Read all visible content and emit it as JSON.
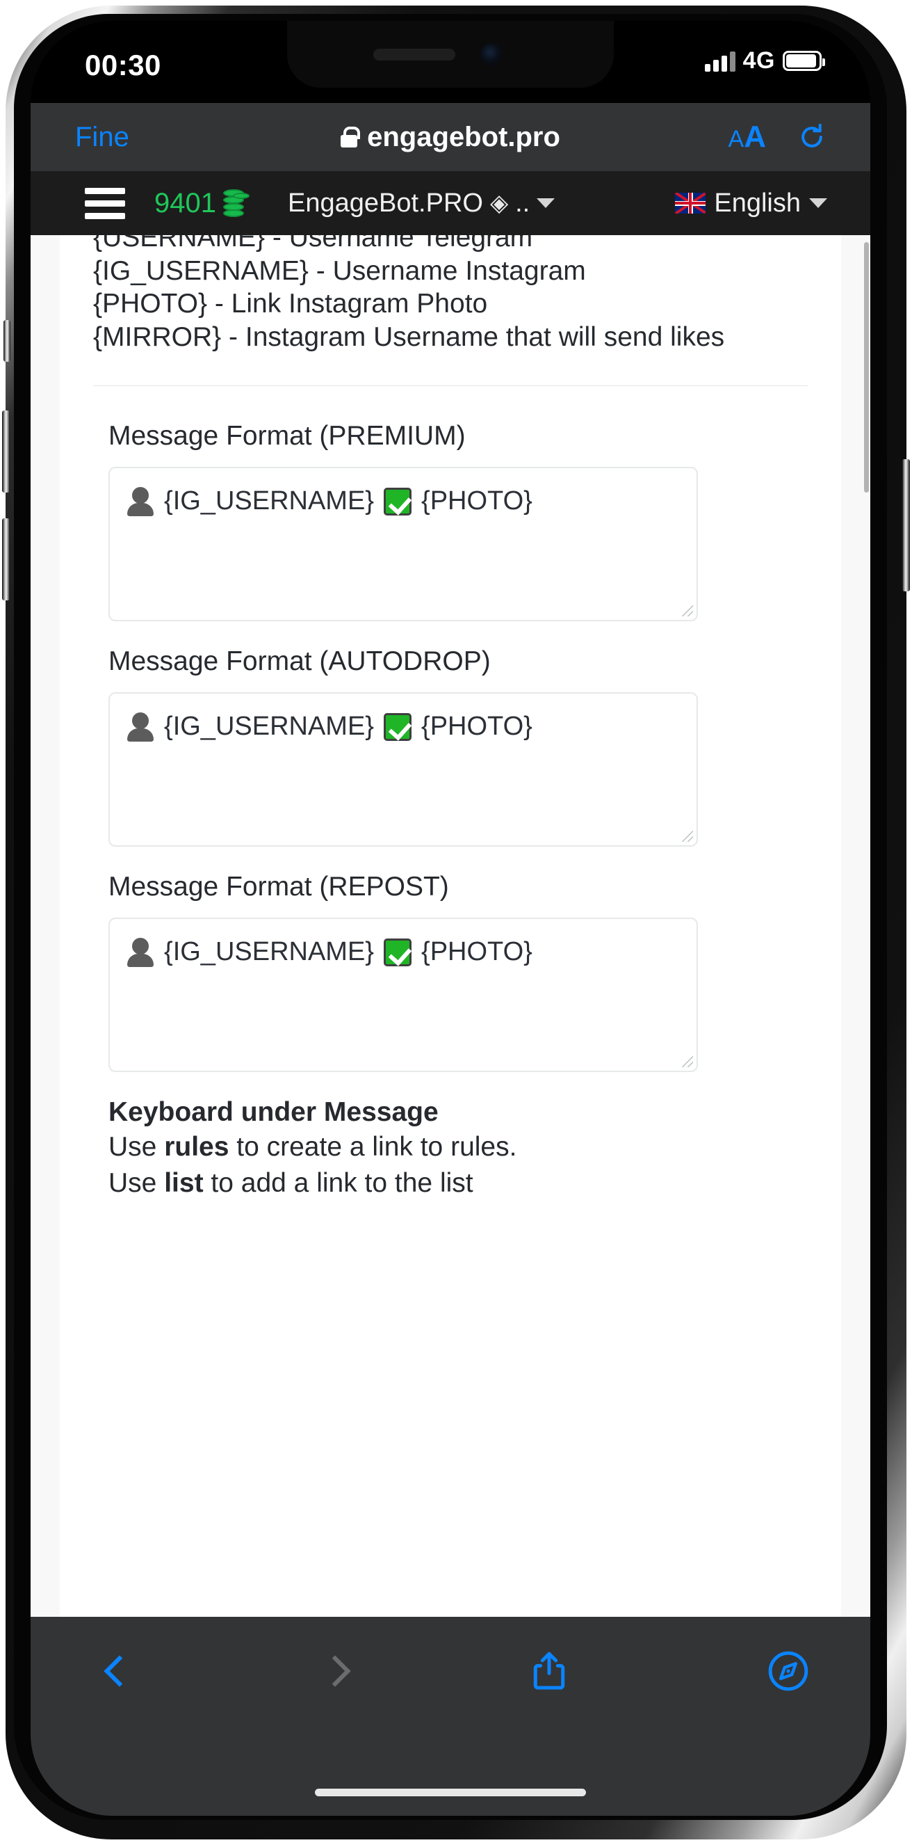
{
  "status_bar": {
    "time": "00:30",
    "network": "4G",
    "signal_icon": "signal-bars-icon",
    "battery_icon": "battery-icon"
  },
  "browser": {
    "back_label": "Fine",
    "url": "engagebot.pro",
    "lock_icon": "lock-icon",
    "text_size_label": "AA",
    "reload_icon": "reload-icon",
    "bottom": {
      "back_icon": "chevron-left-icon",
      "forward_icon": "chevron-right-icon",
      "share_icon": "share-icon",
      "tabs_icon": "compass-icon"
    }
  },
  "app_nav": {
    "menu_icon": "hamburger-menu-icon",
    "coins_value": "9401",
    "coins_icon": "coin-stack-icon",
    "project_name": "EngageBot.PRO",
    "project_glyph": "◈",
    "project_suffix": "..",
    "project_caret_icon": "chevron-down-icon",
    "language": "English",
    "language_flag_icon": "uk-flag-icon",
    "language_caret_icon": "chevron-down-icon"
  },
  "content": {
    "variables": [
      "{USERNAME} - Username Telegram",
      "{IG_USERNAME} - Username Instagram",
      "{PHOTO} - Link Instagram Photo",
      "{MIRROR} - Instagram Username that will send likes"
    ],
    "fields": [
      {
        "label": "Message Format (PREMIUM)",
        "value": "👤 {IG_USERNAME} ✅ {PHOTO}",
        "value_parts": [
          "{IG_USERNAME}",
          "{PHOTO}"
        ],
        "person_icon": "bust-in-silhouette-emoji",
        "check_icon": "white-check-mark-emoji"
      },
      {
        "label": "Message Format (AUTODROP)",
        "value": "👤 {IG_USERNAME} ✅ {PHOTO}",
        "value_parts": [
          "{IG_USERNAME}",
          "{PHOTO}"
        ],
        "person_icon": "bust-in-silhouette-emoji",
        "check_icon": "white-check-mark-emoji"
      },
      {
        "label": "Message Format (REPOST)",
        "value": "👤 {IG_USERNAME} ✅ {PHOTO}",
        "value_parts": [
          "{IG_USERNAME}",
          "{PHOTO}"
        ],
        "person_icon": "bust-in-silhouette-emoji",
        "check_icon": "white-check-mark-emoji"
      }
    ],
    "keyboard_section": {
      "heading": "Keyboard under Message",
      "line1_pre": "Use ",
      "line1_bold": "rules",
      "line1_post": " to create a link to rules.",
      "line2_pre": "Use ",
      "line2_bold": "list",
      "line2_post": " to add a link to the list"
    }
  },
  "colors": {
    "accent_blue": "#0a84ff",
    "coin_green": "#1fc75a",
    "check_green": "#1fb527",
    "nav_dark": "#1c1c1c",
    "safari_chrome": "#333436"
  }
}
